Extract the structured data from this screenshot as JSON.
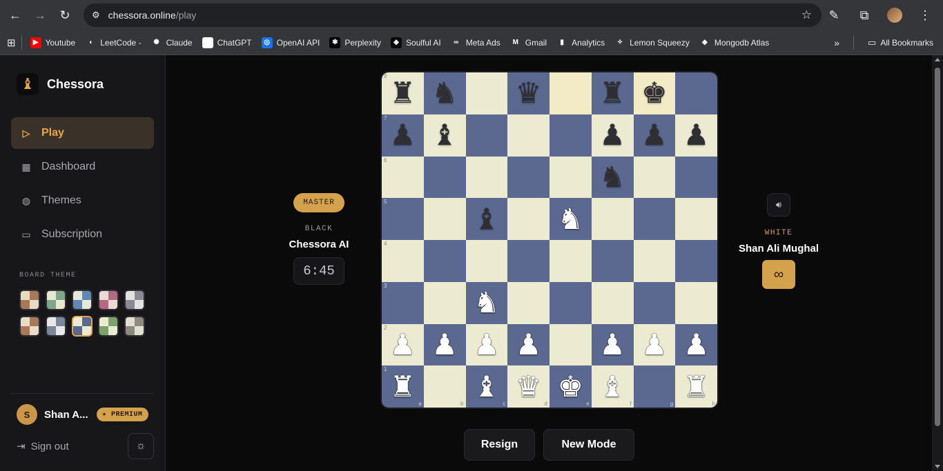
{
  "browser": {
    "url_host": "chessora.online",
    "url_path": "/play",
    "bookmarks": [
      {
        "label": "Youtube",
        "icon": "youtube-icon",
        "color": "#ff0000",
        "glyph": "▶"
      },
      {
        "label": "LeetCode -",
        "icon": "leetcode-icon",
        "color": "#35363a",
        "glyph": "◖"
      },
      {
        "label": "Claude",
        "icon": "claude-icon",
        "color": "#35363a",
        "glyph": "✺"
      },
      {
        "label": "ChatGPT",
        "icon": "chatgpt-icon",
        "color": "#ffffff",
        "glyph": "◎"
      },
      {
        "label": "OpenAI API",
        "icon": "openai-icon",
        "color": "#1a73e8",
        "glyph": "◎"
      },
      {
        "label": "Perplexity",
        "icon": "perplexity-icon",
        "color": "#000000",
        "glyph": "✱"
      },
      {
        "label": "Soulful AI",
        "icon": "soulful-icon",
        "color": "#0a0a0a",
        "glyph": "◈"
      },
      {
        "label": "Meta Ads",
        "icon": "meta-icon",
        "color": "#35363a",
        "glyph": "∞"
      },
      {
        "label": "Gmail",
        "icon": "gmail-icon",
        "color": "#35363a",
        "glyph": "M"
      },
      {
        "label": "Analytics",
        "icon": "analytics-icon",
        "color": "#35363a",
        "glyph": "▮"
      },
      {
        "label": "Lemon Squeezy",
        "icon": "lemonsqueezy-icon",
        "color": "#35363a",
        "glyph": "✧"
      },
      {
        "label": "Mongodb Atlas",
        "icon": "mongodb-icon",
        "color": "#35363a",
        "glyph": "◆"
      }
    ],
    "all_bookmarks": "All Bookmarks"
  },
  "app": {
    "brand": "Chessora",
    "nav": [
      {
        "label": "Play",
        "icon": "play-icon",
        "active": true
      },
      {
        "label": "Dashboard",
        "icon": "dashboard-icon",
        "active": false
      },
      {
        "label": "Themes",
        "icon": "palette-icon",
        "active": false
      },
      {
        "label": "Subscription",
        "icon": "card-icon",
        "active": false
      }
    ],
    "board_theme_label": "BOARD THEME",
    "themes": [
      {
        "a": "#e8dcc0",
        "b": "#a9775a"
      },
      {
        "a": "#e8e8d0",
        "b": "#7fa68a"
      },
      {
        "a": "#e8e8d8",
        "b": "#5f88b4"
      },
      {
        "a": "#eadbd4",
        "b": "#b46a80"
      },
      {
        "a": "#e2e2e2",
        "b": "#8a8a92"
      },
      {
        "a": "#eadcc4",
        "b": "#a67a5a"
      },
      {
        "a": "#e8e8e8",
        "b": "#7a8798"
      },
      {
        "a": "#ecebd2",
        "b": "#5b6990",
        "selected": true
      },
      {
        "a": "#e8ecd0",
        "b": "#7ea36a"
      },
      {
        "a": "#e2e0d2",
        "b": "#8e8a7e"
      }
    ],
    "user": {
      "initial": "S",
      "name": "Shan A...",
      "badge": "★ PREMIUM"
    },
    "sign_out": "Sign out"
  },
  "game": {
    "black": {
      "level": "MASTER",
      "side": "BLACK",
      "name": "Chessora AI",
      "clock": "6:45"
    },
    "white": {
      "side": "WHITE",
      "name": "Shan Ali Mughal",
      "time_mode": "∞"
    },
    "files": [
      "a",
      "b",
      "c",
      "d",
      "e",
      "f",
      "g",
      "h"
    ],
    "highlight": [
      "e8",
      "g8"
    ],
    "position": [
      [
        "r",
        "n",
        "",
        "q",
        "",
        "r",
        "k",
        ""
      ],
      [
        "p",
        "b",
        "",
        "",
        "",
        "p",
        "p",
        "p"
      ],
      [
        "",
        "",
        "",
        "",
        "",
        "n",
        "",
        ""
      ],
      [
        "",
        "",
        "b",
        "",
        "N",
        "",
        "",
        ""
      ],
      [
        "",
        "",
        "",
        "",
        "",
        "",
        "",
        ""
      ],
      [
        "",
        "",
        "N",
        "",
        "",
        "",
        "",
        ""
      ],
      [
        "P",
        "P",
        "P",
        "P",
        "",
        "P",
        "P",
        "P"
      ],
      [
        "R",
        "",
        "B",
        "Q",
        "K",
        "B",
        "",
        "R"
      ]
    ],
    "actions": {
      "resign": "Resign",
      "new_mode": "New Mode"
    }
  }
}
